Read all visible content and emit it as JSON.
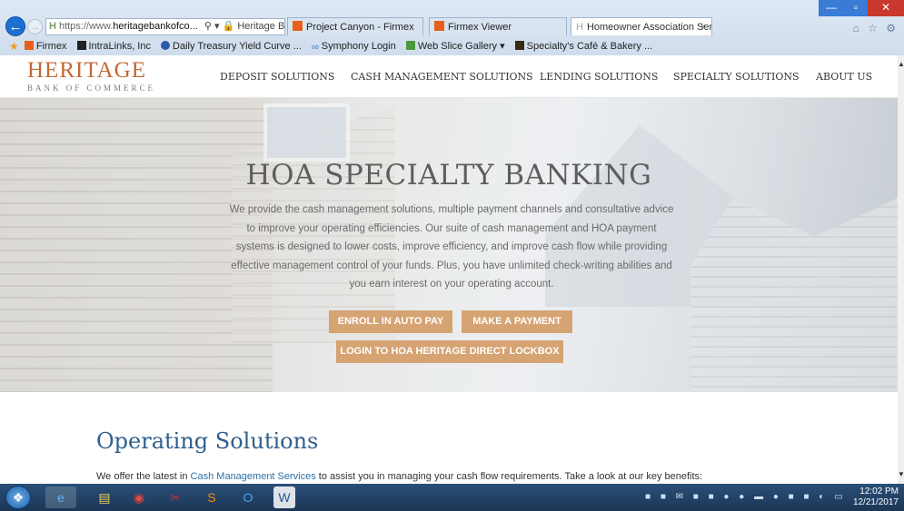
{
  "browser": {
    "address": {
      "favicon": "H",
      "url_prefix": "https://www.",
      "url_domain": "heritagebankofco...",
      "icons": "⚲ ▾ 🔒 Heritage Ba... ↻"
    },
    "tabs": [
      {
        "label": "Project Canyon - Firmex"
      },
      {
        "label": "Firmex Viewer"
      },
      {
        "label": "Homeowner Association Ser...",
        "close": "×",
        "favicon": "H"
      }
    ],
    "window_buttons": {
      "minimize": "—",
      "maximize": "▫",
      "close": "✕"
    },
    "right_icons": "⌂ ☆ ⚙",
    "favorites": [
      {
        "label": "Firmex",
        "icon": "firmex-icon"
      },
      {
        "label": "IntraLinks, Inc",
        "icon": "intralinks-icon"
      },
      {
        "label": "Daily Treasury Yield Curve ...",
        "icon": "treasury-icon"
      },
      {
        "label": "Symphony Login",
        "icon": "symphony-icon"
      },
      {
        "label": "Web Slice Gallery ▾",
        "icon": "web-slice-icon"
      },
      {
        "label": "Specialty's Café & Bakery ...",
        "icon": "cafe-icon"
      }
    ]
  },
  "site": {
    "logo": {
      "title": "HERITAGE",
      "subtitle": "BANK OF COMMERCE"
    },
    "nav": [
      "DEPOSIT SOLUTIONS",
      "CASH MANAGEMENT SOLUTIONS",
      "LENDING SOLUTIONS",
      "SPECIALTY SOLUTIONS",
      "ABOUT US"
    ],
    "hero": {
      "title": "HOA SPECIALTY BANKING",
      "text": "We provide the cash management solutions, multiple payment channels and consultative advice to improve your operating efficiencies. Our suite of cash management and HOA payment systems is designed to lower costs, improve efficiency, and improve cash flow while providing effective management control of your funds. Plus, you have unlimited check-writing abilities and you earn interest on your operating account.",
      "buttons": {
        "enroll": "ENROLL IN AUTO PAY",
        "pay": "MAKE A PAYMENT",
        "lockbox": "LOGIN TO HOA HERITAGE DIRECT LOCKBOX"
      }
    },
    "section": {
      "title": "Operating Solutions",
      "text_before": "We offer the latest in ",
      "link": "Cash Management Services",
      "text_after": " to assist you in managing your cash flow requirements. Take a look at our key benefits:"
    }
  },
  "taskbar": {
    "icons": [
      "start",
      "internet-explorer",
      "file-explorer",
      "chrome",
      "snipping-tool",
      "sublime",
      "outlook",
      "word"
    ],
    "tray": "■ ■ ✉ ■ ■ ● ● ▬ ● ■ ■ ◐ ▭",
    "time": "12:02 PM",
    "date": "12/21/2017"
  },
  "colors": {
    "brand": "#c06a36",
    "button": "#d6a373",
    "heading": "#2f5f8d",
    "link": "#2f6fa8"
  }
}
